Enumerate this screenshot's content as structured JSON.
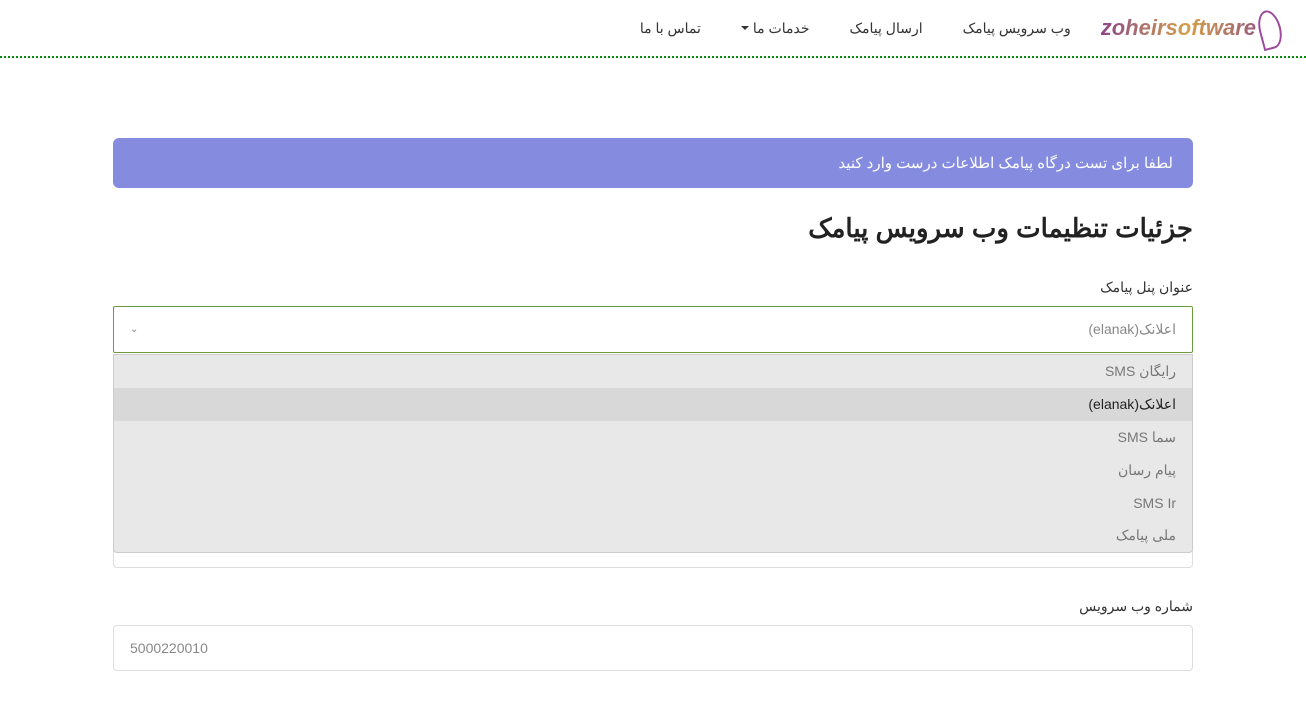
{
  "logo": "zoheirsoftware",
  "nav": {
    "webservice": "وب سرویس پیامک",
    "send": "ارسال پیامک",
    "services": "خدمات ما",
    "contact": "تماس با ما"
  },
  "alert": "لطفا برای تست درگاه پیامک اطلاعات درست وارد کنید",
  "page_title": "جزئیات تنظیمات وب سرویس پیامک",
  "panel_label": "عنوان پنل پیامک",
  "panel_selected": "اعلانک(elanak)",
  "panel_options": [
    "رایگان SMS",
    "اعلانک(elanak)",
    "سما SMS",
    "پیام رسان",
    "SMS Ir",
    "ملی پیامک"
  ],
  "service_number_label": "شماره وب سرویس",
  "service_number_value": "5000220010"
}
